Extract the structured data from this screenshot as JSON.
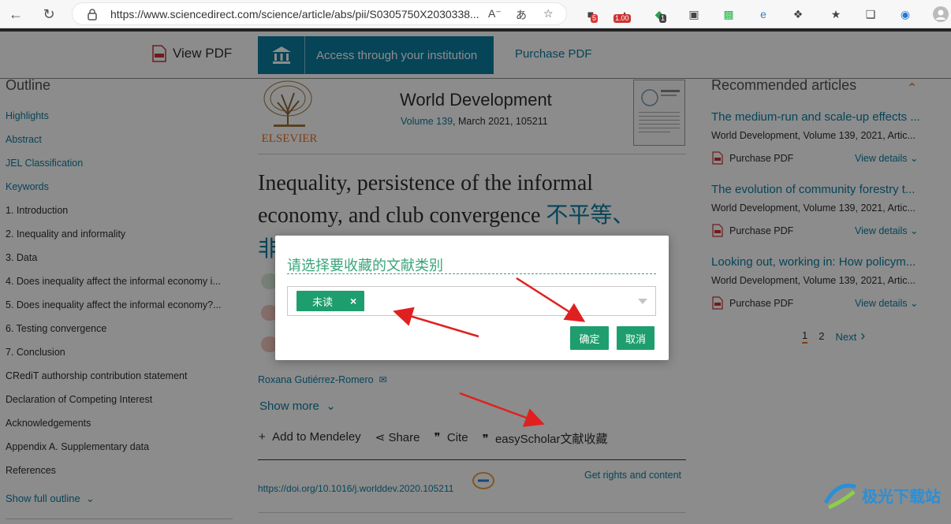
{
  "browser": {
    "url": "https://www.sciencedirect.com/science/article/abs/pii/S0305750X2030338...",
    "ext_badge_1": "5",
    "ext_badge_2": "1.00",
    "ext_badge_3": "1"
  },
  "topbar": {
    "view_pdf": "View PDF",
    "access": "Access through your institution",
    "purchase": "Purchase PDF"
  },
  "outline": {
    "title": "Outline",
    "items": [
      "Highlights",
      "Abstract",
      "JEL Classification",
      "Keywords",
      "1. Introduction",
      "2. Inequality and informality",
      "3. Data",
      "4. Does inequality affect the informal economy i...",
      "5. Does inequality affect the informal economy?...",
      "6. Testing convergence",
      "7. Conclusion",
      "CRediT authorship contribution statement",
      "Declaration of Competing Interest",
      "Acknowledgements",
      "Appendix A. Supplementary data",
      "References"
    ],
    "show_full": "Show full outline"
  },
  "article": {
    "publisher": "ELSEVIER",
    "journal": "World Development",
    "volume_link": "Volume 139",
    "volume_rest": ", March 2021, 105211",
    "title_1": "Inequality, persistence of the informal",
    "title_2": "economy, and club convergence",
    "title_cn": "不平等、",
    "title_cn_2": "非",
    "author": "Roxana Gutiérrez-Romero",
    "show_more": "Show more",
    "actions": {
      "mendeley": "Add to Mendeley",
      "share": "Share",
      "cite": "Cite",
      "easyscholar": "easyScholar文献收藏"
    },
    "doi": "https://doi.org/10.1016/j.worlddev.2020.105211",
    "rights": "Get rights and content"
  },
  "recommended": {
    "title": "Recommended articles",
    "items": [
      {
        "title": "The medium-run and scale-up effects ...",
        "meta": "World Development, Volume 139, 2021, Artic...",
        "pdf": "Purchase PDF",
        "view": "View details"
      },
      {
        "title": "The evolution of community forestry t...",
        "meta": "World Development, Volume 139, 2021, Artic...",
        "pdf": "Purchase PDF",
        "view": "View details"
      },
      {
        "title": "Looking out, working in: How policym...",
        "meta": "World Development, Volume 139, 2021, Artic...",
        "pdf": "Purchase PDF",
        "view": "View details"
      }
    ],
    "pager": {
      "p1": "1",
      "p2": "2",
      "next": "Next"
    }
  },
  "dialog": {
    "title": "请选择要收藏的文献类别",
    "tag": "未读",
    "tag_remove": "×",
    "confirm": "确定",
    "cancel": "取消"
  },
  "watermark": {
    "text": "极光下载站"
  },
  "colors": {
    "accent": "#0c7da0",
    "dialog_green": "#1e9e6e",
    "arrow_red": "#e02020",
    "orange": "#e9711c"
  }
}
